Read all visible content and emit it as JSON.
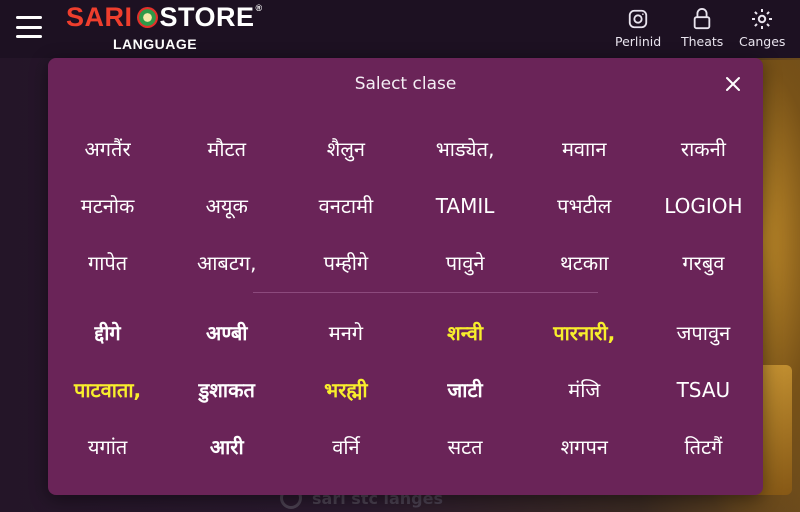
{
  "header": {
    "logo_left": "SARI",
    "logo_right": "STORE",
    "logo_mark": "®",
    "subtitle": "LANGUAGE",
    "actions": [
      {
        "label": "Perlinid",
        "icon": "instagram-icon"
      },
      {
        "label": "Theats",
        "icon": "lock-icon"
      },
      {
        "label": "Canges",
        "icon": "gear-icon"
      }
    ]
  },
  "background": {
    "search_text": "sari stc langes"
  },
  "modal": {
    "title": "Salect clase",
    "close_icon": "close-icon",
    "top_languages": [
      {
        "label": "अगतैंर"
      },
      {
        "label": "मौटत"
      },
      {
        "label": "शैलुन"
      },
      {
        "label": "भाड्येत,"
      },
      {
        "label": "मवाान"
      },
      {
        "label": "राकनी"
      },
      {
        "label": "मटनोक"
      },
      {
        "label": "अयूक"
      },
      {
        "label": "वनटामी"
      },
      {
        "label": "TAMIL"
      },
      {
        "label": "पभटील"
      },
      {
        "label": "LOGIOH"
      },
      {
        "label": "गापेत"
      },
      {
        "label": "आबटग,"
      },
      {
        "label": "पम्हीगे"
      },
      {
        "label": "पावुने"
      },
      {
        "label": "थटकाा"
      },
      {
        "label": "गरबुव"
      }
    ],
    "bottom_languages": [
      {
        "label": "द्दीगे",
        "style": "bold"
      },
      {
        "label": "अण्बी",
        "style": "bold"
      },
      {
        "label": "मनगे",
        "style": "normal"
      },
      {
        "label": "शन्वी",
        "style": "highlight"
      },
      {
        "label": "पारनारी,",
        "style": "highlight"
      },
      {
        "label": "जपावुन",
        "style": "normal"
      },
      {
        "label": "पाटवाता,",
        "style": "highlight"
      },
      {
        "label": "डुशाकत",
        "style": "bold"
      },
      {
        "label": "भरह्मी",
        "style": "highlight"
      },
      {
        "label": "जाटी",
        "style": "bold"
      },
      {
        "label": "मंजि",
        "style": "normal"
      },
      {
        "label": "TSAU",
        "style": "normal"
      },
      {
        "label": "यगांत",
        "style": "normal"
      },
      {
        "label": "आरी",
        "style": "bold"
      },
      {
        "label": "वर्नि",
        "style": "normal"
      },
      {
        "label": "सटत",
        "style": "normal"
      },
      {
        "label": "शगपन",
        "style": "normal"
      },
      {
        "label": "तिटगैं",
        "style": "normal"
      }
    ]
  },
  "colors": {
    "modal_bg": "#6a2458",
    "highlight": "#f8ee2c",
    "logo_red": "#ef3e2d"
  }
}
